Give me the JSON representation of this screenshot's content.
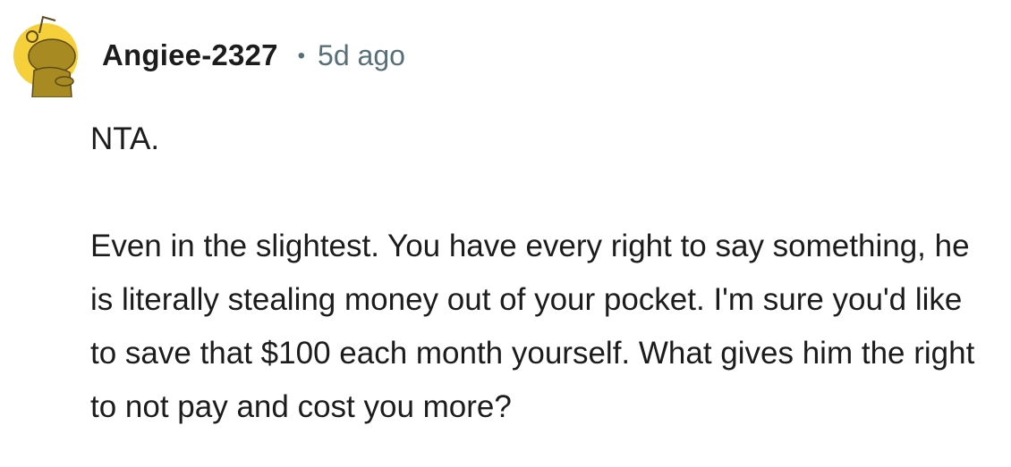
{
  "comment": {
    "avatar_icon": "reddit-snoo-avatar-icon",
    "avatar_color": "#f5d03a",
    "username": "Angiee-2327",
    "separator": "•",
    "timestamp": "5d ago",
    "paragraphs": [
      "NTA.",
      "Even in the slightest. You have every right to say something, he is literally stealing money out of your pocket. I'm sure you'd like to save that $100 each month yourself. What gives him the right to not pay and cost you more?"
    ]
  }
}
